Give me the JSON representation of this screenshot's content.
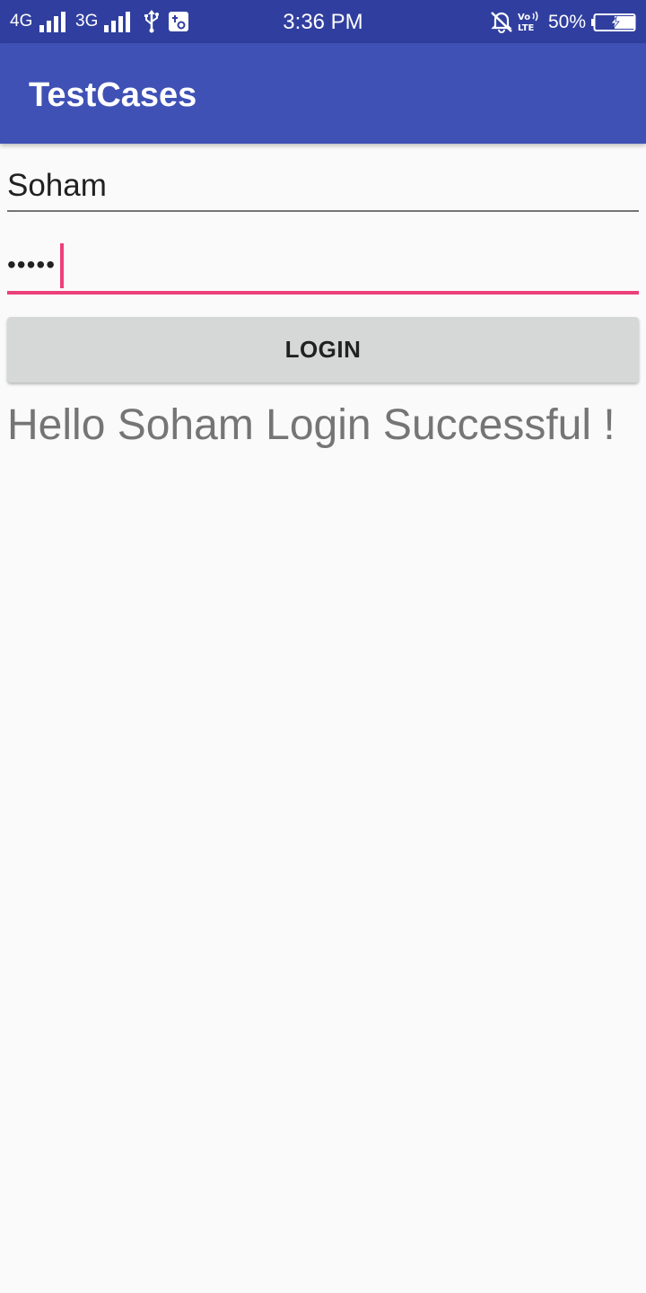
{
  "status_bar": {
    "network1": "4G",
    "network2": "3G",
    "time": "3:36 PM",
    "battery_percent": "50%",
    "battery_level": 0.5,
    "icons": [
      "signal-icon",
      "signal-icon",
      "usb-icon",
      "debug-icon",
      "alarm-off-icon",
      "volte-icon",
      "battery-charging-icon"
    ]
  },
  "app_bar": {
    "title": "TestCases"
  },
  "form": {
    "username_value": "Soham",
    "password_value": "•••••",
    "login_label": "LOGIN",
    "accent_color": "#ec407a"
  },
  "result": {
    "message": "Hello Soham Login Successful !"
  },
  "colors": {
    "status_bar": "#303f9f",
    "app_bar": "#3f51b5",
    "background": "#fafafa"
  }
}
